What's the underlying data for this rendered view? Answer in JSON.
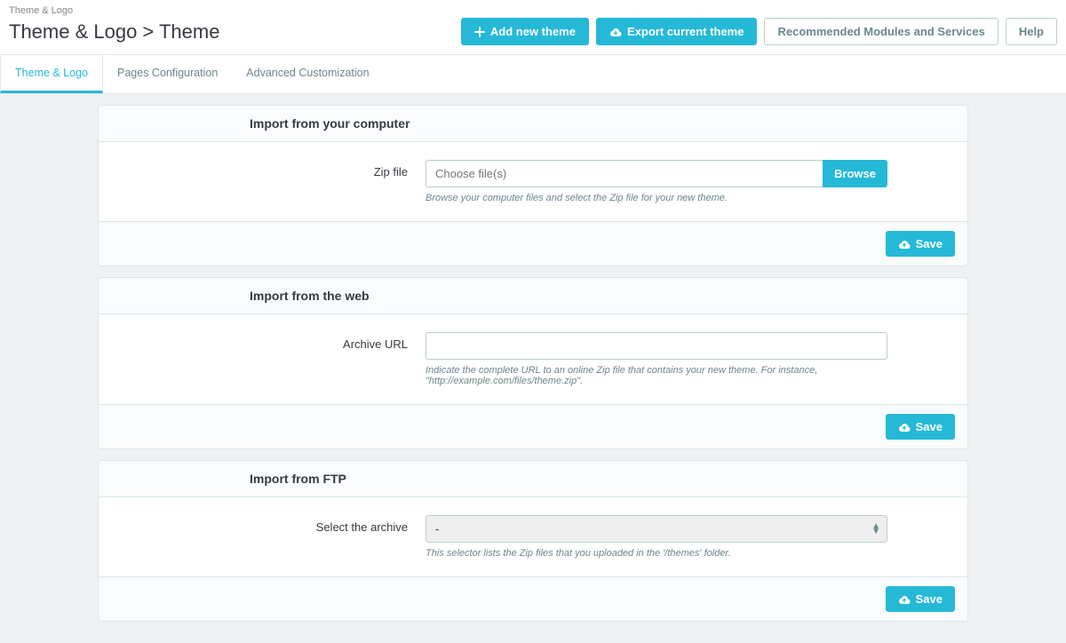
{
  "breadcrumb": "Theme & Logo",
  "page_title": "Theme & Logo > Theme",
  "header_actions": {
    "add_theme": "Add new theme",
    "export_theme": "Export current theme",
    "recommended": "Recommended Modules and Services",
    "help": "Help"
  },
  "tabs": [
    {
      "label": "Theme & Logo"
    },
    {
      "label": "Pages Configuration"
    },
    {
      "label": "Advanced Customization"
    }
  ],
  "panels": {
    "computer": {
      "title": "Import from your computer",
      "label": "Zip file",
      "placeholder": "Choose file(s)",
      "browse": "Browse",
      "help": "Browse your computer files and select the Zip file for your new theme.",
      "save": "Save"
    },
    "web": {
      "title": "Import from the web",
      "label": "Archive URL",
      "help": "Indicate the complete URL to an online Zip file that contains your new theme. For instance, \"http://example.com/files/theme.zip\".",
      "save": "Save"
    },
    "ftp": {
      "title": "Import from FTP",
      "label": "Select the archive",
      "selected": "-",
      "help": "This selector lists the Zip files that you uploaded in the '/themes' folder.",
      "save": "Save"
    }
  }
}
